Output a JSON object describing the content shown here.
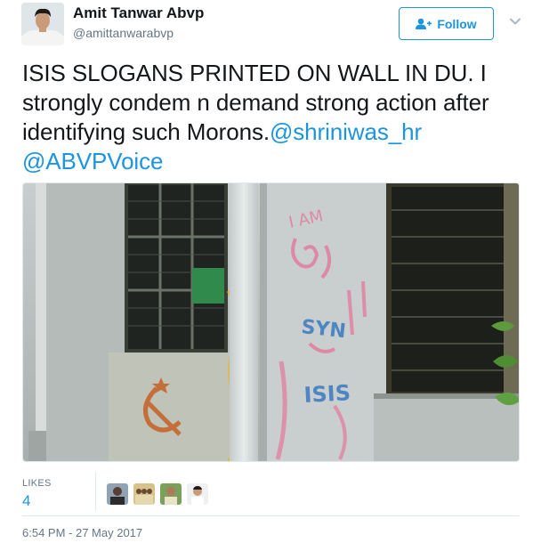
{
  "author": {
    "name": "Amit Tanwar Abvp",
    "handle": "@amittanwarabvp",
    "avatar_icon": "profile-photo"
  },
  "follow_button": {
    "label": "Follow",
    "icon": "add-user-icon",
    "color": "#1b95e0"
  },
  "menu_icon": "chevron-down-icon",
  "tweet": {
    "text": "ISIS SLOGANS PRINTED ON WALL IN DU. I strongly condem n demand strong action after identifying such Morons.",
    "mentions": [
      "@shriniwas_hr",
      "@ABVPVoice"
    ],
    "mention_color": "#1b95e0"
  },
  "media": {
    "graffiti": [
      "I AM",
      "SYN",
      "ISIS"
    ]
  },
  "stats": {
    "likes_label": "LIKES",
    "likes_count": "4",
    "liker_icons": [
      "avatar-icon",
      "avatar-icon",
      "avatar-icon",
      "avatar-icon"
    ]
  },
  "timestamp": "6:54 PM - 27 May 2017"
}
